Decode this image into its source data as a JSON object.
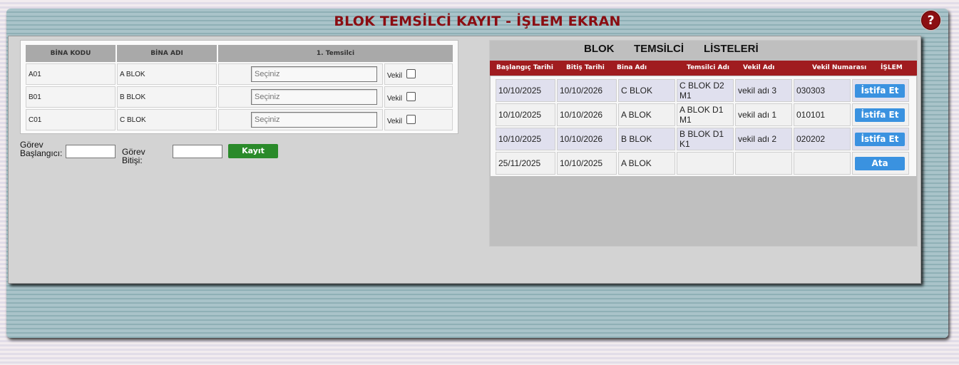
{
  "title": "BLOK TEMSİLCİ KAYIT - İŞLEM EKRAN",
  "help_label": "?",
  "left_table": {
    "headers": [
      "BİNA KODU",
      "BİNA ADI",
      "1. Temsilci"
    ],
    "rows": [
      {
        "code": "A01",
        "name": "A BLOK",
        "placeholder": "Seçiniz",
        "vekil": "Vekil"
      },
      {
        "code": "B01",
        "name": "B BLOK",
        "placeholder": "Seçiniz",
        "vekil": "Vekil"
      },
      {
        "code": "C01",
        "name": "C BLOK",
        "placeholder": "Seçiniz",
        "vekil": "Vekil"
      }
    ]
  },
  "form": {
    "start_label_line1": "Görev",
    "start_label_line2": "Başlangıcı:",
    "end_label": "Görev Bitişi:",
    "save_label": "Kayıt"
  },
  "right": {
    "heading": [
      "BLOK",
      "TEMSİLCİ",
      "LİSTELERİ"
    ],
    "columns": [
      "Başlangıç Tarihi",
      "Bitiş Tarihi",
      "Bina Adı",
      "Temsilci Adı",
      "Vekil Adı",
      "Vekil Numarası",
      "İŞLEM"
    ],
    "rows": [
      {
        "start": "10/10/2025",
        "end": "10/10/2026",
        "bina": "C BLOK",
        "temsilci": "C BLOK D2 M1",
        "vekil": "vekil adı 3",
        "numara": "030303",
        "action": "İstifa Et"
      },
      {
        "start": "10/10/2025",
        "end": "10/10/2026",
        "bina": "A BLOK",
        "temsilci": "A BLOK D1 M1",
        "vekil": "vekil adı 1",
        "numara": "010101",
        "action": "İstifa Et"
      },
      {
        "start": "10/10/2025",
        "end": "10/10/2026",
        "bina": "B BLOK",
        "temsilci": "B BLOK D1 K1",
        "vekil": "vekil adı 2",
        "numara": "020202",
        "action": "İstifa Et"
      },
      {
        "start": "25/11/2025",
        "end": "10/10/2025",
        "bina": "A BLOK",
        "temsilci": "",
        "vekil": "",
        "numara": "",
        "action": "Ata"
      }
    ]
  },
  "colors": {
    "title": "#8a0d12",
    "header_bar": "#a01c1f",
    "save_button": "#2a8a2a",
    "action_button": "#3a92e0"
  }
}
